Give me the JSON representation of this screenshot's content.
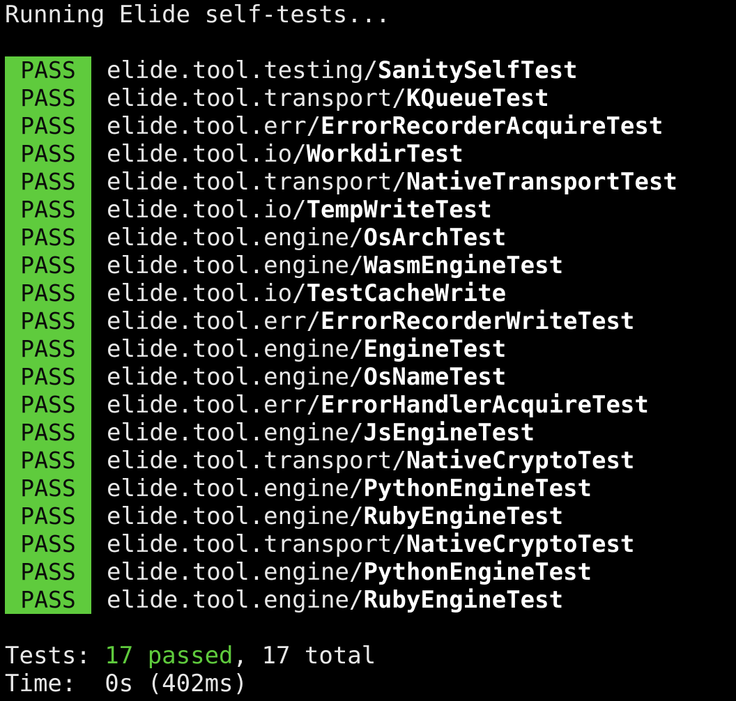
{
  "terminal": {
    "header": "Running Elide self-tests...",
    "badge_color": "#5fcb3d",
    "background": "#000000",
    "results": [
      {
        "status": "PASS",
        "package": "elide.tool.testing/",
        "test": "SanitySelfTest"
      },
      {
        "status": "PASS",
        "package": "elide.tool.transport/",
        "test": "KQueueTest"
      },
      {
        "status": "PASS",
        "package": "elide.tool.err/",
        "test": "ErrorRecorderAcquireTest"
      },
      {
        "status": "PASS",
        "package": "elide.tool.io/",
        "test": "WorkdirTest"
      },
      {
        "status": "PASS",
        "package": "elide.tool.transport/",
        "test": "NativeTransportTest"
      },
      {
        "status": "PASS",
        "package": "elide.tool.io/",
        "test": "TempWriteTest"
      },
      {
        "status": "PASS",
        "package": "elide.tool.engine/",
        "test": "OsArchTest"
      },
      {
        "status": "PASS",
        "package": "elide.tool.engine/",
        "test": "WasmEngineTest"
      },
      {
        "status": "PASS",
        "package": "elide.tool.io/",
        "test": "TestCacheWrite"
      },
      {
        "status": "PASS",
        "package": "elide.tool.err/",
        "test": "ErrorRecorderWriteTest"
      },
      {
        "status": "PASS",
        "package": "elide.tool.engine/",
        "test": "EngineTest"
      },
      {
        "status": "PASS",
        "package": "elide.tool.engine/",
        "test": "OsNameTest"
      },
      {
        "status": "PASS",
        "package": "elide.tool.err/",
        "test": "ErrorHandlerAcquireTest"
      },
      {
        "status": "PASS",
        "package": "elide.tool.engine/",
        "test": "JsEngineTest"
      },
      {
        "status": "PASS",
        "package": "elide.tool.transport/",
        "test": "NativeCryptoTest"
      },
      {
        "status": "PASS",
        "package": "elide.tool.engine/",
        "test": "PythonEngineTest"
      },
      {
        "status": "PASS",
        "package": "elide.tool.engine/",
        "test": "RubyEngineTest"
      },
      {
        "status": "PASS",
        "package": "elide.tool.transport/",
        "test": "NativeCryptoTest"
      },
      {
        "status": "PASS",
        "package": "elide.tool.engine/",
        "test": "PythonEngineTest"
      },
      {
        "status": "PASS",
        "package": "elide.tool.engine/",
        "test": "RubyEngineTest"
      }
    ],
    "summary": {
      "tests_label": "Tests: ",
      "passed": "17 passed",
      "total": ", 17 total",
      "time_label": "Time:  ",
      "time_value": "0s (402ms)"
    }
  }
}
